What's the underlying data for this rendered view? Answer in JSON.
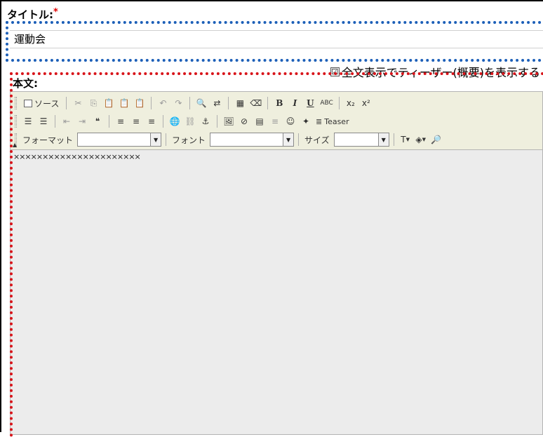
{
  "title_field": {
    "label": "タイトル:",
    "required_mark": "*",
    "value": "運動会"
  },
  "teaser": {
    "checkbox_mark": "☑",
    "label": "全文表示でティーザー(概要)を表示する"
  },
  "body_field": {
    "label": "本文:"
  },
  "toolbar": {
    "source_label": "ソース",
    "cut_icon": "✂",
    "copy_icon": "⎘",
    "paste_icon": "📋",
    "paste_text_icon": "📋",
    "paste_word_icon": "📋",
    "undo_icon": "↶",
    "redo_icon": "↷",
    "find_icon": "🔍",
    "replace_icon": "⇄",
    "select_all_icon": "▦",
    "remove_format_icon": "⌫",
    "bold_label": "B",
    "italic_label": "I",
    "underline_label": "U",
    "strike_label": "ABC",
    "subscript_label": "x₂",
    "superscript_label": "x²",
    "ordered_list_icon": "☰",
    "unordered_list_icon": "☰",
    "outdent_icon": "⇤",
    "indent_icon": "⇥",
    "blockquote_icon": "❝",
    "align_left_icon": "≡",
    "align_center_icon": "≡",
    "align_right_icon": "≡",
    "link_icon": "🌐",
    "unlink_icon": "⛓",
    "anchor_icon": "⚓",
    "image_icon": "🖼",
    "flash_icon": "⊘",
    "table_icon": "▤",
    "hr_icon": "≡",
    "smiley_icon": "☺",
    "special_char_icon": "✦",
    "teaser_break_icon": "≣",
    "teaser_label": "Teaser",
    "format_label": "フォーマット",
    "font_label": "フォント",
    "size_label": "サイズ",
    "text_color_icon": "T",
    "bg_color_icon": "◈",
    "preview_icon": "🔎",
    "dropdown_arrow": "▼",
    "collapse_icon": "▲"
  },
  "editor": {
    "content": "××××××××××××××××××××××"
  },
  "colors": {
    "title_outline": "#1c5fb8",
    "body_outline": "#d8141a",
    "required": "#e00000",
    "toolbar_bg": "#efefde",
    "editor_bg": "#ececec"
  }
}
